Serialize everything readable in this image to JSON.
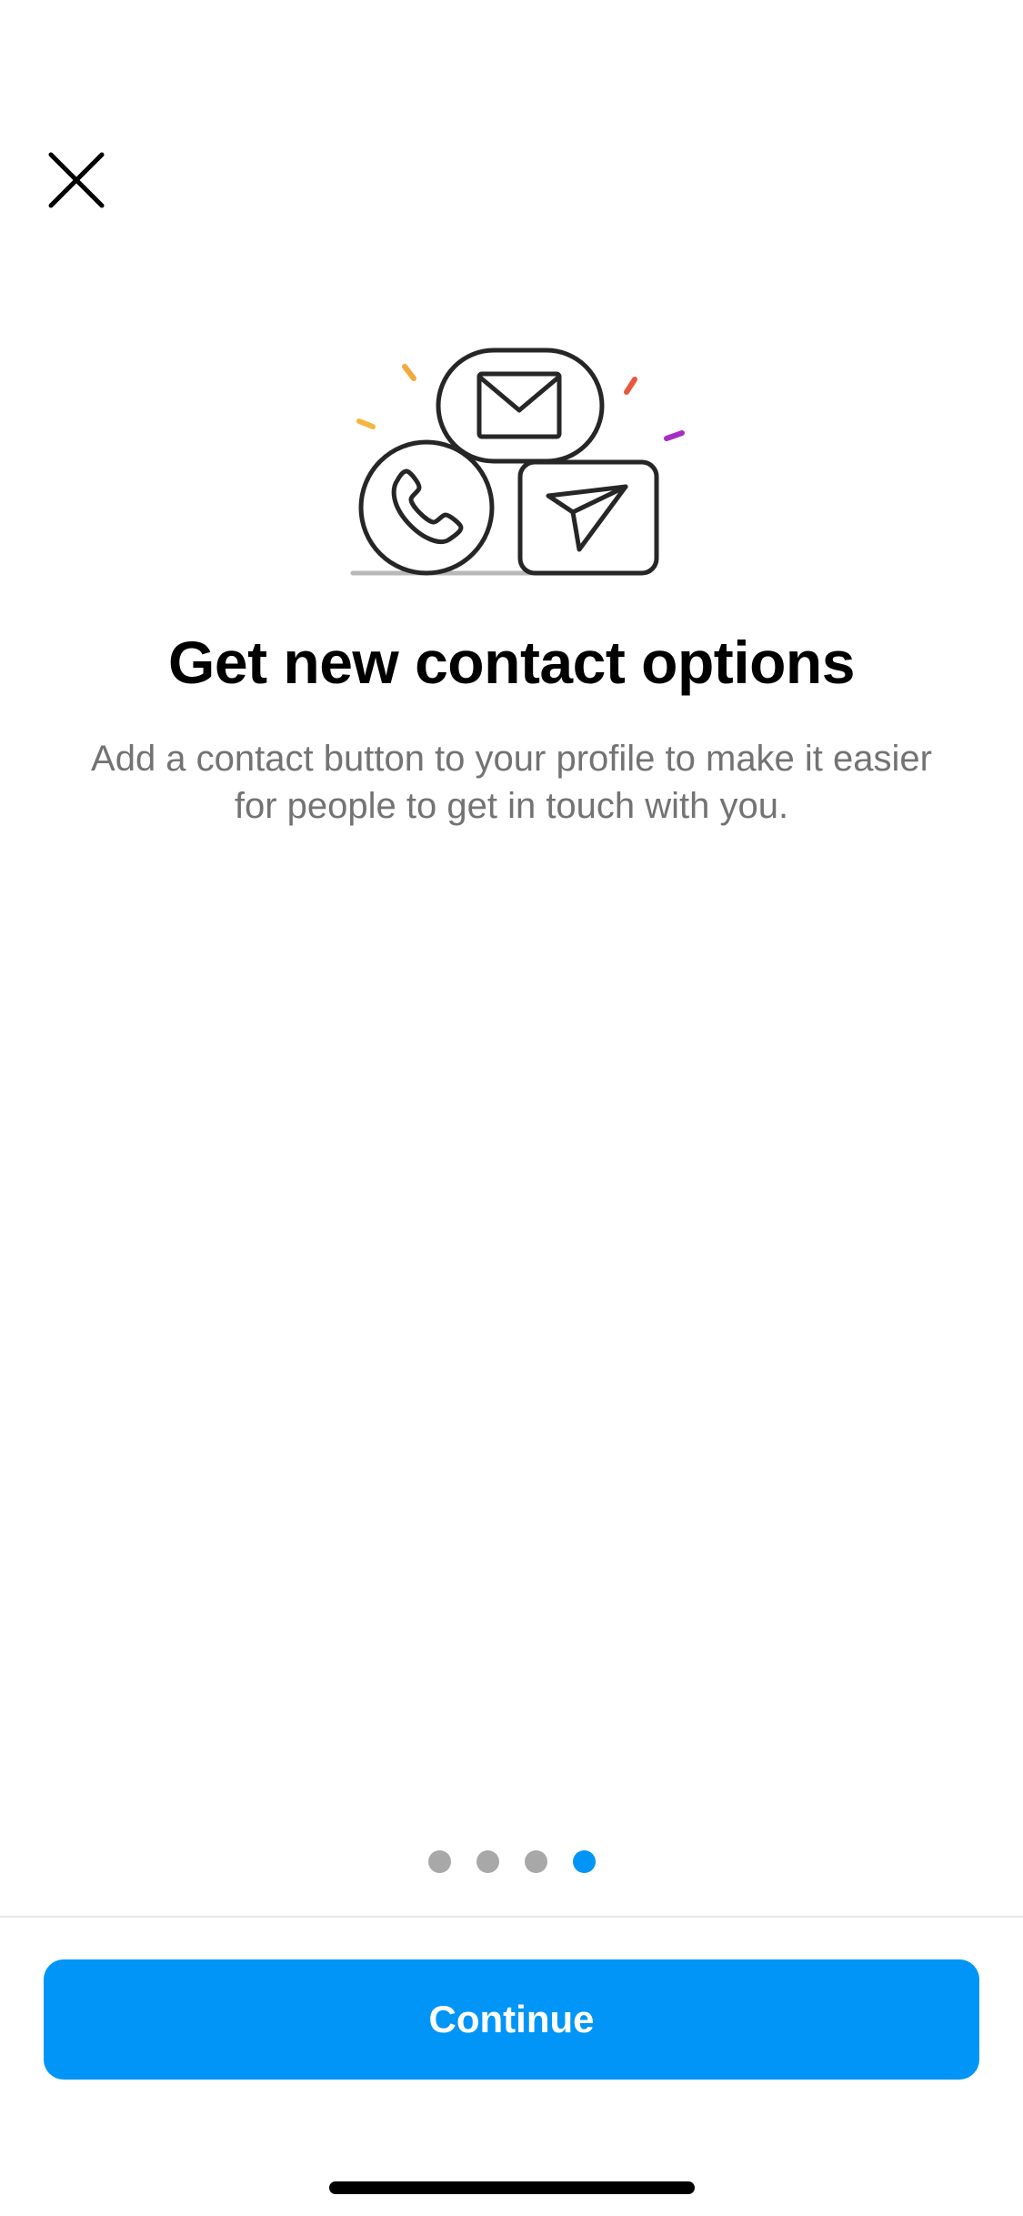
{
  "colors": {
    "accent": "#0095F6",
    "dot_inactive": "#A8A8A8",
    "text_primary": "#000000",
    "text_secondary": "#737373"
  },
  "header": {
    "close_icon": "close-icon"
  },
  "illustration": {
    "icons": [
      "mail-icon",
      "phone-icon",
      "send-icon"
    ]
  },
  "content": {
    "title": "Get new contact options",
    "description": "Add a contact button to your profile to make it easier for people to get in touch with you."
  },
  "pager": {
    "total": 4,
    "active_index": 3
  },
  "footer": {
    "continue_label": "Continue"
  }
}
